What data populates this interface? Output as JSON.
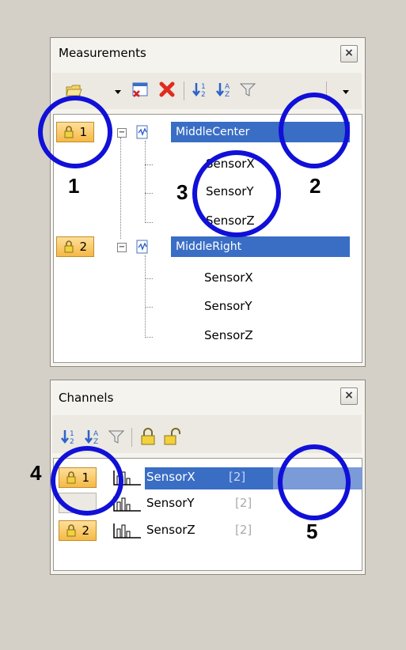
{
  "measurements": {
    "title": "Measurements",
    "close_label": "×",
    "groups": [
      {
        "lock_number": "1",
        "name": "MiddleCenter",
        "channels": [
          "SensorX",
          "SensorY",
          "SensorZ"
        ]
      },
      {
        "lock_number": "2",
        "name": "MiddleRight",
        "channels": [
          "SensorX",
          "SensorY",
          "SensorZ"
        ]
      }
    ]
  },
  "channels": {
    "title": "Channels",
    "close_label": "×",
    "rows": [
      {
        "lock_number": "1",
        "name": "SensorX",
        "count": "[2]"
      },
      {
        "lock_number": "",
        "name": "SensorY",
        "count": "[2]"
      },
      {
        "lock_number": "2",
        "name": "SensorZ",
        "count": "[2]"
      }
    ]
  },
  "callouts": [
    "1",
    "2",
    "3",
    "4",
    "5"
  ],
  "colors": {
    "selection": "#3a6ec5",
    "circle": "#1010d8",
    "lock_badge": "#f5b946"
  }
}
